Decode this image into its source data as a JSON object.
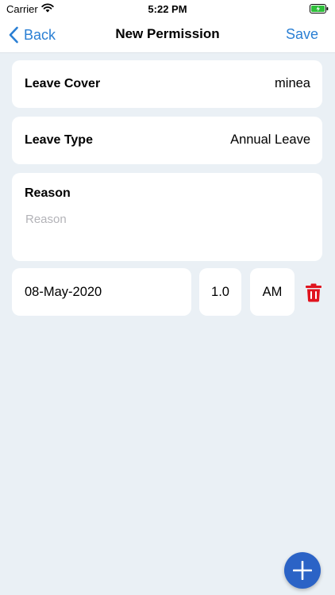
{
  "status_bar": {
    "carrier": "Carrier",
    "time": "5:22 PM",
    "wifi_icon": "wifi-icon",
    "battery_icon": "battery-charging-icon",
    "battery_color": "#2fbf3b"
  },
  "nav": {
    "back_label": "Back",
    "title": "New Permission",
    "save_label": "Save",
    "accent_color": "#2a7fd4"
  },
  "form": {
    "leave_cover": {
      "label": "Leave Cover",
      "value": "minea"
    },
    "leave_type": {
      "label": "Leave Type",
      "value": "Annual Leave"
    },
    "reason": {
      "label": "Reason",
      "placeholder": "Reason",
      "value": ""
    }
  },
  "entries": [
    {
      "date": "08-May-2020",
      "days": "1.0",
      "period": "AM",
      "delete_icon": "trash-icon",
      "delete_color": "#e0141e"
    }
  ],
  "fab": {
    "icon": "plus-icon",
    "color": "#2b63c6"
  }
}
